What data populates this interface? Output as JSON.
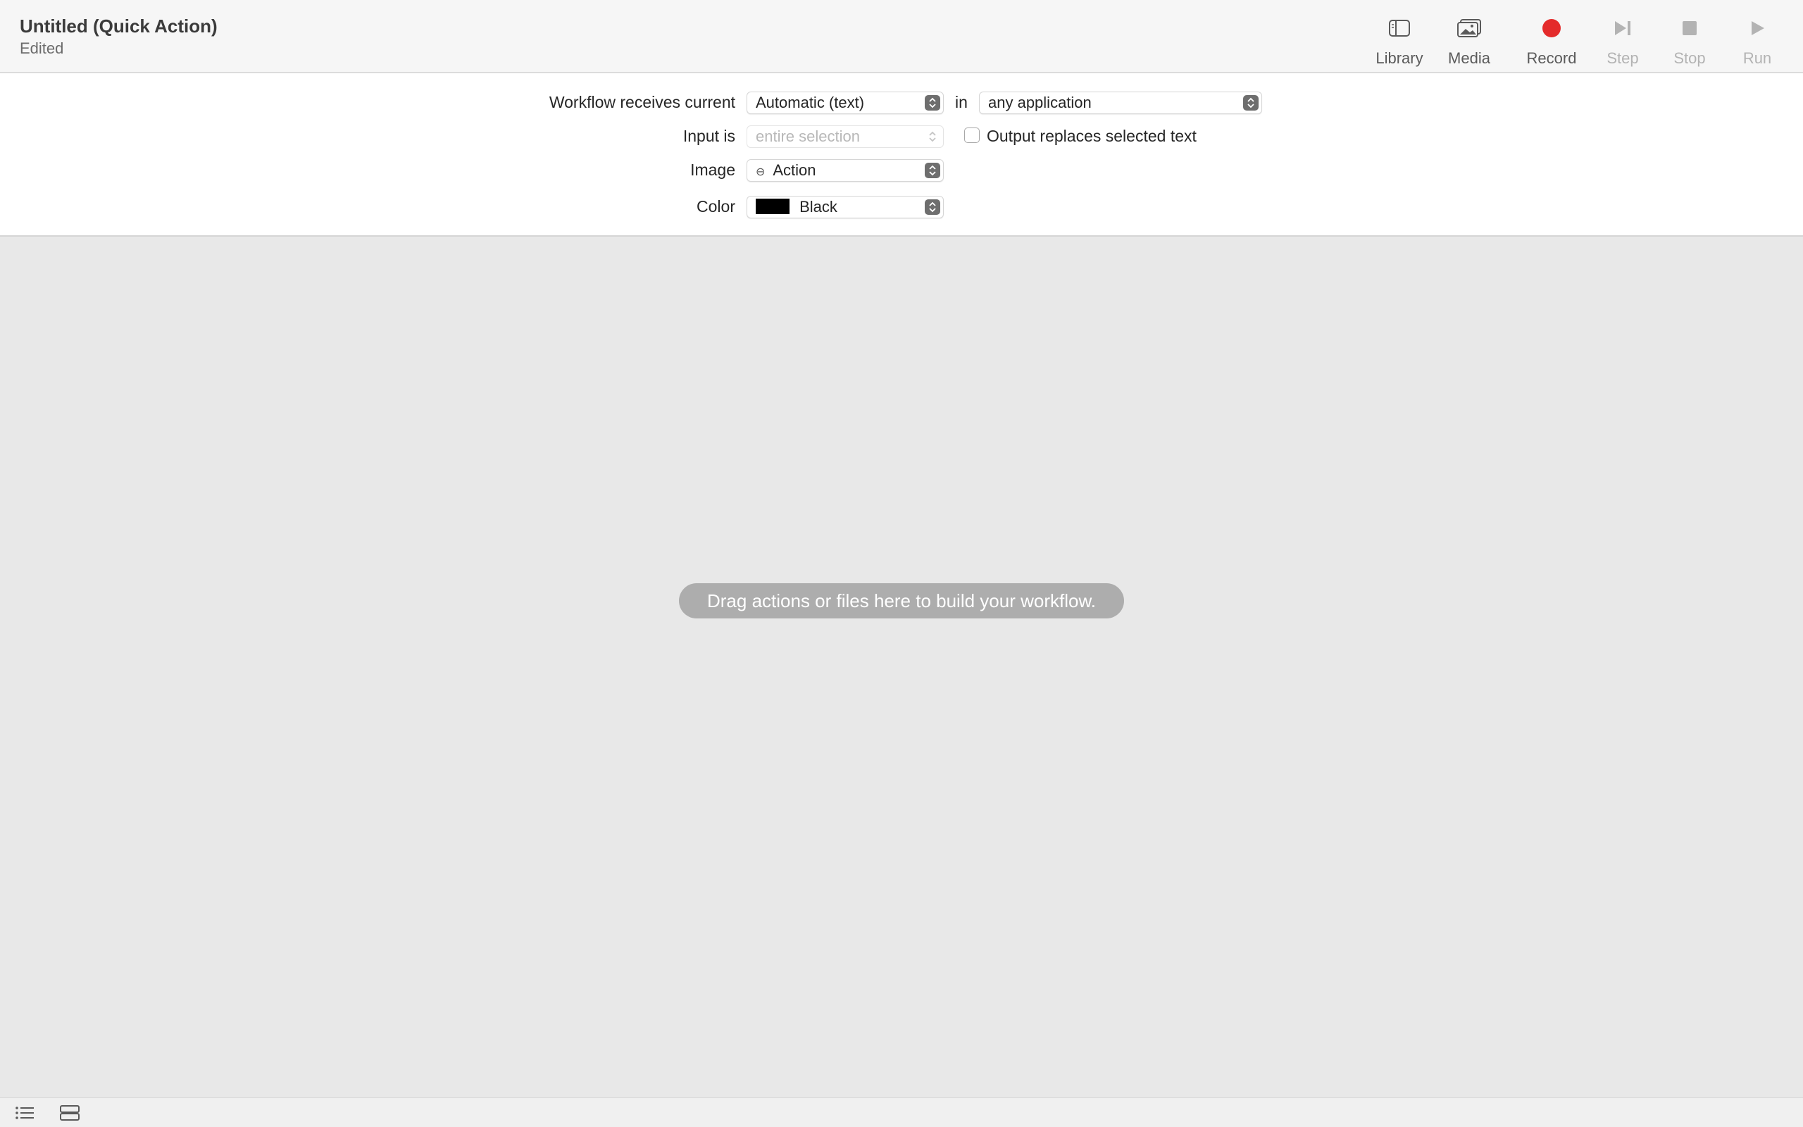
{
  "window": {
    "title": "Untitled (Quick Action)",
    "subtitle": "Edited"
  },
  "toolbar": {
    "library": {
      "label": "Library",
      "icon": "sidebar-icon"
    },
    "media": {
      "label": "Media",
      "icon": "photos-icon"
    },
    "record": {
      "label": "Record",
      "icon": "record-icon",
      "color": "#e42b2b"
    },
    "step": {
      "label": "Step",
      "icon": "step-icon"
    },
    "stop": {
      "label": "Stop",
      "icon": "stop-icon"
    },
    "run": {
      "label": "Run",
      "icon": "play-icon"
    }
  },
  "config": {
    "receives_label": "Workflow receives current",
    "receives_value": "Automatic (text)",
    "in_label": "in",
    "application_value": "any application",
    "input_label": "Input is",
    "input_value": "entire selection",
    "output_replaces_label": "Output replaces selected text",
    "output_replaces_checked": false,
    "image_label": "Image",
    "image_value": "Action",
    "color_label": "Color",
    "color_value": "Black",
    "color_swatch": "#000000"
  },
  "canvas": {
    "hint": "Drag actions or files here to build your workflow."
  },
  "statusbar": {
    "list_view_icon": "list-icon",
    "stacked_view_icon": "stacked-rows-icon"
  }
}
